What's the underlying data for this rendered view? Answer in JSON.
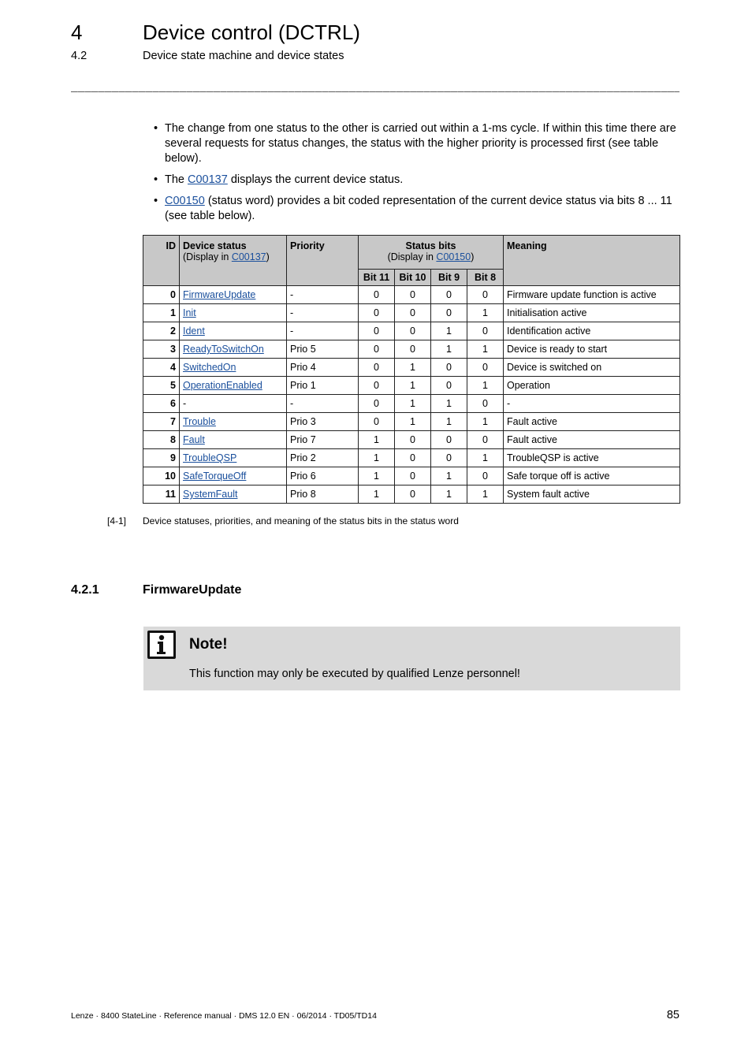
{
  "header": {
    "chapter_number": "4",
    "chapter_title": "Device control (DCTRL)",
    "section_number": "4.2",
    "section_title": "Device state machine and device states",
    "separator": "_____________________________________________________________________________________________"
  },
  "bullets": [
    {
      "pre": "The change from one status to the other is carried out within a 1-ms cycle. If within this time there are several requests for status changes, the status with the higher priority is processed first (see table below).",
      "link": "",
      "post": ""
    },
    {
      "pre": "The ",
      "link": "C00137",
      "post": " displays the current device status."
    },
    {
      "pre": "",
      "link": "C00150",
      "post": " (status word) provides a bit coded representation of the current device status via bits 8 ... 11 (see table below)."
    }
  ],
  "bullet_glyph": "•",
  "table": {
    "headers": {
      "id": "ID",
      "status": "Device status",
      "status_sub_pre": "(Display in ",
      "status_sub_link": "C00137",
      "status_sub_post": ")",
      "priority": "Priority",
      "bits": "Status bits",
      "bits_sub_pre": "(Display in ",
      "bits_sub_link": "C00150",
      "bits_sub_post": ")",
      "meaning": "Meaning",
      "bit_columns": [
        "Bit 11",
        "Bit 10",
        "Bit 9",
        "Bit 8"
      ]
    },
    "rows": [
      {
        "id": "0",
        "status": "FirmwareUpdate",
        "link": true,
        "priority": "-",
        "bits": [
          "0",
          "0",
          "0",
          "0"
        ],
        "meaning": "Firmware update function is active"
      },
      {
        "id": "1",
        "status": "Init",
        "link": true,
        "priority": "-",
        "bits": [
          "0",
          "0",
          "0",
          "1"
        ],
        "meaning": "Initialisation active"
      },
      {
        "id": "2",
        "status": "Ident",
        "link": true,
        "priority": "-",
        "bits": [
          "0",
          "0",
          "1",
          "0"
        ],
        "meaning": "Identification active"
      },
      {
        "id": "3",
        "status": "ReadyToSwitchOn",
        "link": true,
        "priority": "Prio 5",
        "bits": [
          "0",
          "0",
          "1",
          "1"
        ],
        "meaning": "Device is ready to start"
      },
      {
        "id": "4",
        "status": "SwitchedOn",
        "link": true,
        "priority": "Prio 4",
        "bits": [
          "0",
          "1",
          "0",
          "0"
        ],
        "meaning": "Device is switched on"
      },
      {
        "id": "5",
        "status": "OperationEnabled",
        "link": true,
        "priority": "Prio 1",
        "bits": [
          "0",
          "1",
          "0",
          "1"
        ],
        "meaning": "Operation"
      },
      {
        "id": "6",
        "status": "-",
        "link": false,
        "priority": "-",
        "bits": [
          "0",
          "1",
          "1",
          "0"
        ],
        "meaning": "-"
      },
      {
        "id": "7",
        "status": "Trouble",
        "link": true,
        "priority": "Prio 3",
        "bits": [
          "0",
          "1",
          "1",
          "1"
        ],
        "meaning": "Fault active"
      },
      {
        "id": "8",
        "status": "Fault",
        "link": true,
        "priority": "Prio 7",
        "bits": [
          "1",
          "0",
          "0",
          "0"
        ],
        "meaning": "Fault active"
      },
      {
        "id": "9",
        "status": "TroubleQSP",
        "link": true,
        "priority": "Prio 2",
        "bits": [
          "1",
          "0",
          "0",
          "1"
        ],
        "meaning": "TroubleQSP is active"
      },
      {
        "id": "10",
        "status": "SafeTorqueOff",
        "link": true,
        "priority": "Prio 6",
        "bits": [
          "1",
          "0",
          "1",
          "0"
        ],
        "meaning": "Safe torque off is active"
      },
      {
        "id": "11",
        "status": "SystemFault",
        "link": true,
        "priority": "Prio 8",
        "bits": [
          "1",
          "0",
          "1",
          "1"
        ],
        "meaning": "System fault active"
      }
    ]
  },
  "caption": {
    "number": "[4-1]",
    "text": "Device statuses, priorities, and meaning of the status bits in the status word"
  },
  "subsection": {
    "number": "4.2.1",
    "title": "FirmwareUpdate"
  },
  "note": {
    "icon": "info-icon",
    "title": "Note!",
    "text": "This function may only be executed by qualified Lenze personnel!"
  },
  "colors": {
    "link": "#1a4f9c",
    "table_header_bg": "#c8c8c8",
    "note_bg": "#d9d9d9"
  },
  "footer": {
    "left": "Lenze · 8400 StateLine · Reference manual · DMS 12.0 EN · 06/2014 · TD05/TD14",
    "page_number": "85"
  }
}
